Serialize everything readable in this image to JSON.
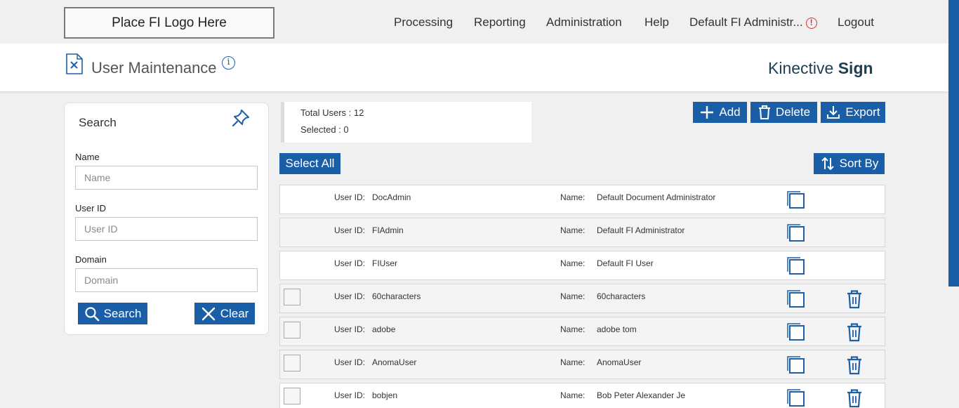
{
  "header": {
    "logo_text": "Place FI Logo Here",
    "nav": [
      "Processing",
      "Reporting",
      "Administration",
      "Help",
      "Default FI Administr...",
      "Logout"
    ]
  },
  "page": {
    "title": "User Maintenance",
    "brand_light": "Kinective",
    "brand_bold": "Sign"
  },
  "search": {
    "title": "Search",
    "name_label": "Name",
    "name_placeholder": "Name",
    "userid_label": "User ID",
    "userid_placeholder": "User ID",
    "domain_label": "Domain",
    "domain_placeholder": "Domain",
    "search_button": "Search",
    "clear_button": "Clear"
  },
  "summary": {
    "total_users": "Total Users : 12",
    "selected": "Selected : 0"
  },
  "toolbar": {
    "add": "Add",
    "delete": "Delete",
    "export": "Export",
    "select_all": "Select All",
    "sort_by": "Sort By"
  },
  "list": {
    "userid_label": "User ID:",
    "name_label": "Name:",
    "rows": [
      {
        "user_id": "DocAdmin",
        "name": "Default Document Administrator",
        "selectable": false
      },
      {
        "user_id": "FIAdmin",
        "name": "Default FI Administrator",
        "selectable": false
      },
      {
        "user_id": "FIUser",
        "name": "Default FI User",
        "selectable": false
      },
      {
        "user_id": "60characters",
        "name": "60characters",
        "selectable": true
      },
      {
        "user_id": "adobe",
        "name": "adobe tom",
        "selectable": true
      },
      {
        "user_id": "AnomaUser",
        "name": "AnomaUser",
        "selectable": true
      },
      {
        "user_id": "bobjen",
        "name": "Bob Peter Alexander Je",
        "selectable": true
      }
    ]
  },
  "colors": {
    "accent": "#1a5ea8",
    "brand_text": "#1c3f52",
    "alert": "#d9302c"
  },
  "icons": [
    "page-tools-icon",
    "info-icon",
    "alert-icon",
    "pin-icon",
    "search-icon",
    "close-icon",
    "plus-icon",
    "trash-icon",
    "download-icon",
    "sort-icon",
    "copy-icon"
  ]
}
